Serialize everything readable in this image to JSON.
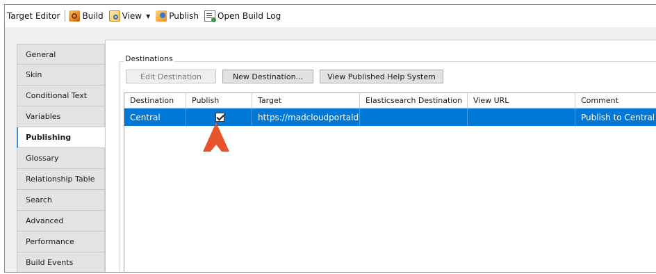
{
  "toolbar": {
    "title": "Target Editor",
    "build_label": "Build",
    "view_label": "View",
    "publish_label": "Publish",
    "open_build_log_label": "Open Build Log"
  },
  "sidebar": {
    "items": [
      {
        "label": "General"
      },
      {
        "label": "Skin"
      },
      {
        "label": "Conditional Text"
      },
      {
        "label": "Variables"
      },
      {
        "label": "Publishing",
        "active": true
      },
      {
        "label": "Glossary"
      },
      {
        "label": "Relationship Table"
      },
      {
        "label": "Search"
      },
      {
        "label": "Advanced"
      },
      {
        "label": "Performance"
      },
      {
        "label": "Build Events"
      }
    ]
  },
  "destinations": {
    "group_label": "Destinations",
    "buttons": {
      "edit": "Edit Destination",
      "new": "New Destination...",
      "view_published": "View Published Help System"
    },
    "columns": [
      "Destination",
      "Publish",
      "Target",
      "Elasticsearch Destination",
      "View URL",
      "Comment"
    ],
    "rows": [
      {
        "destination": "Central",
        "publish": true,
        "target": "https://madcloudportald...",
        "elasticsearch_destination": "",
        "view_url": "",
        "comment": "Publish to Central",
        "selected": true
      }
    ]
  },
  "colors": {
    "selection": "#0078d7",
    "annotation_arrow": "#e8522d"
  }
}
